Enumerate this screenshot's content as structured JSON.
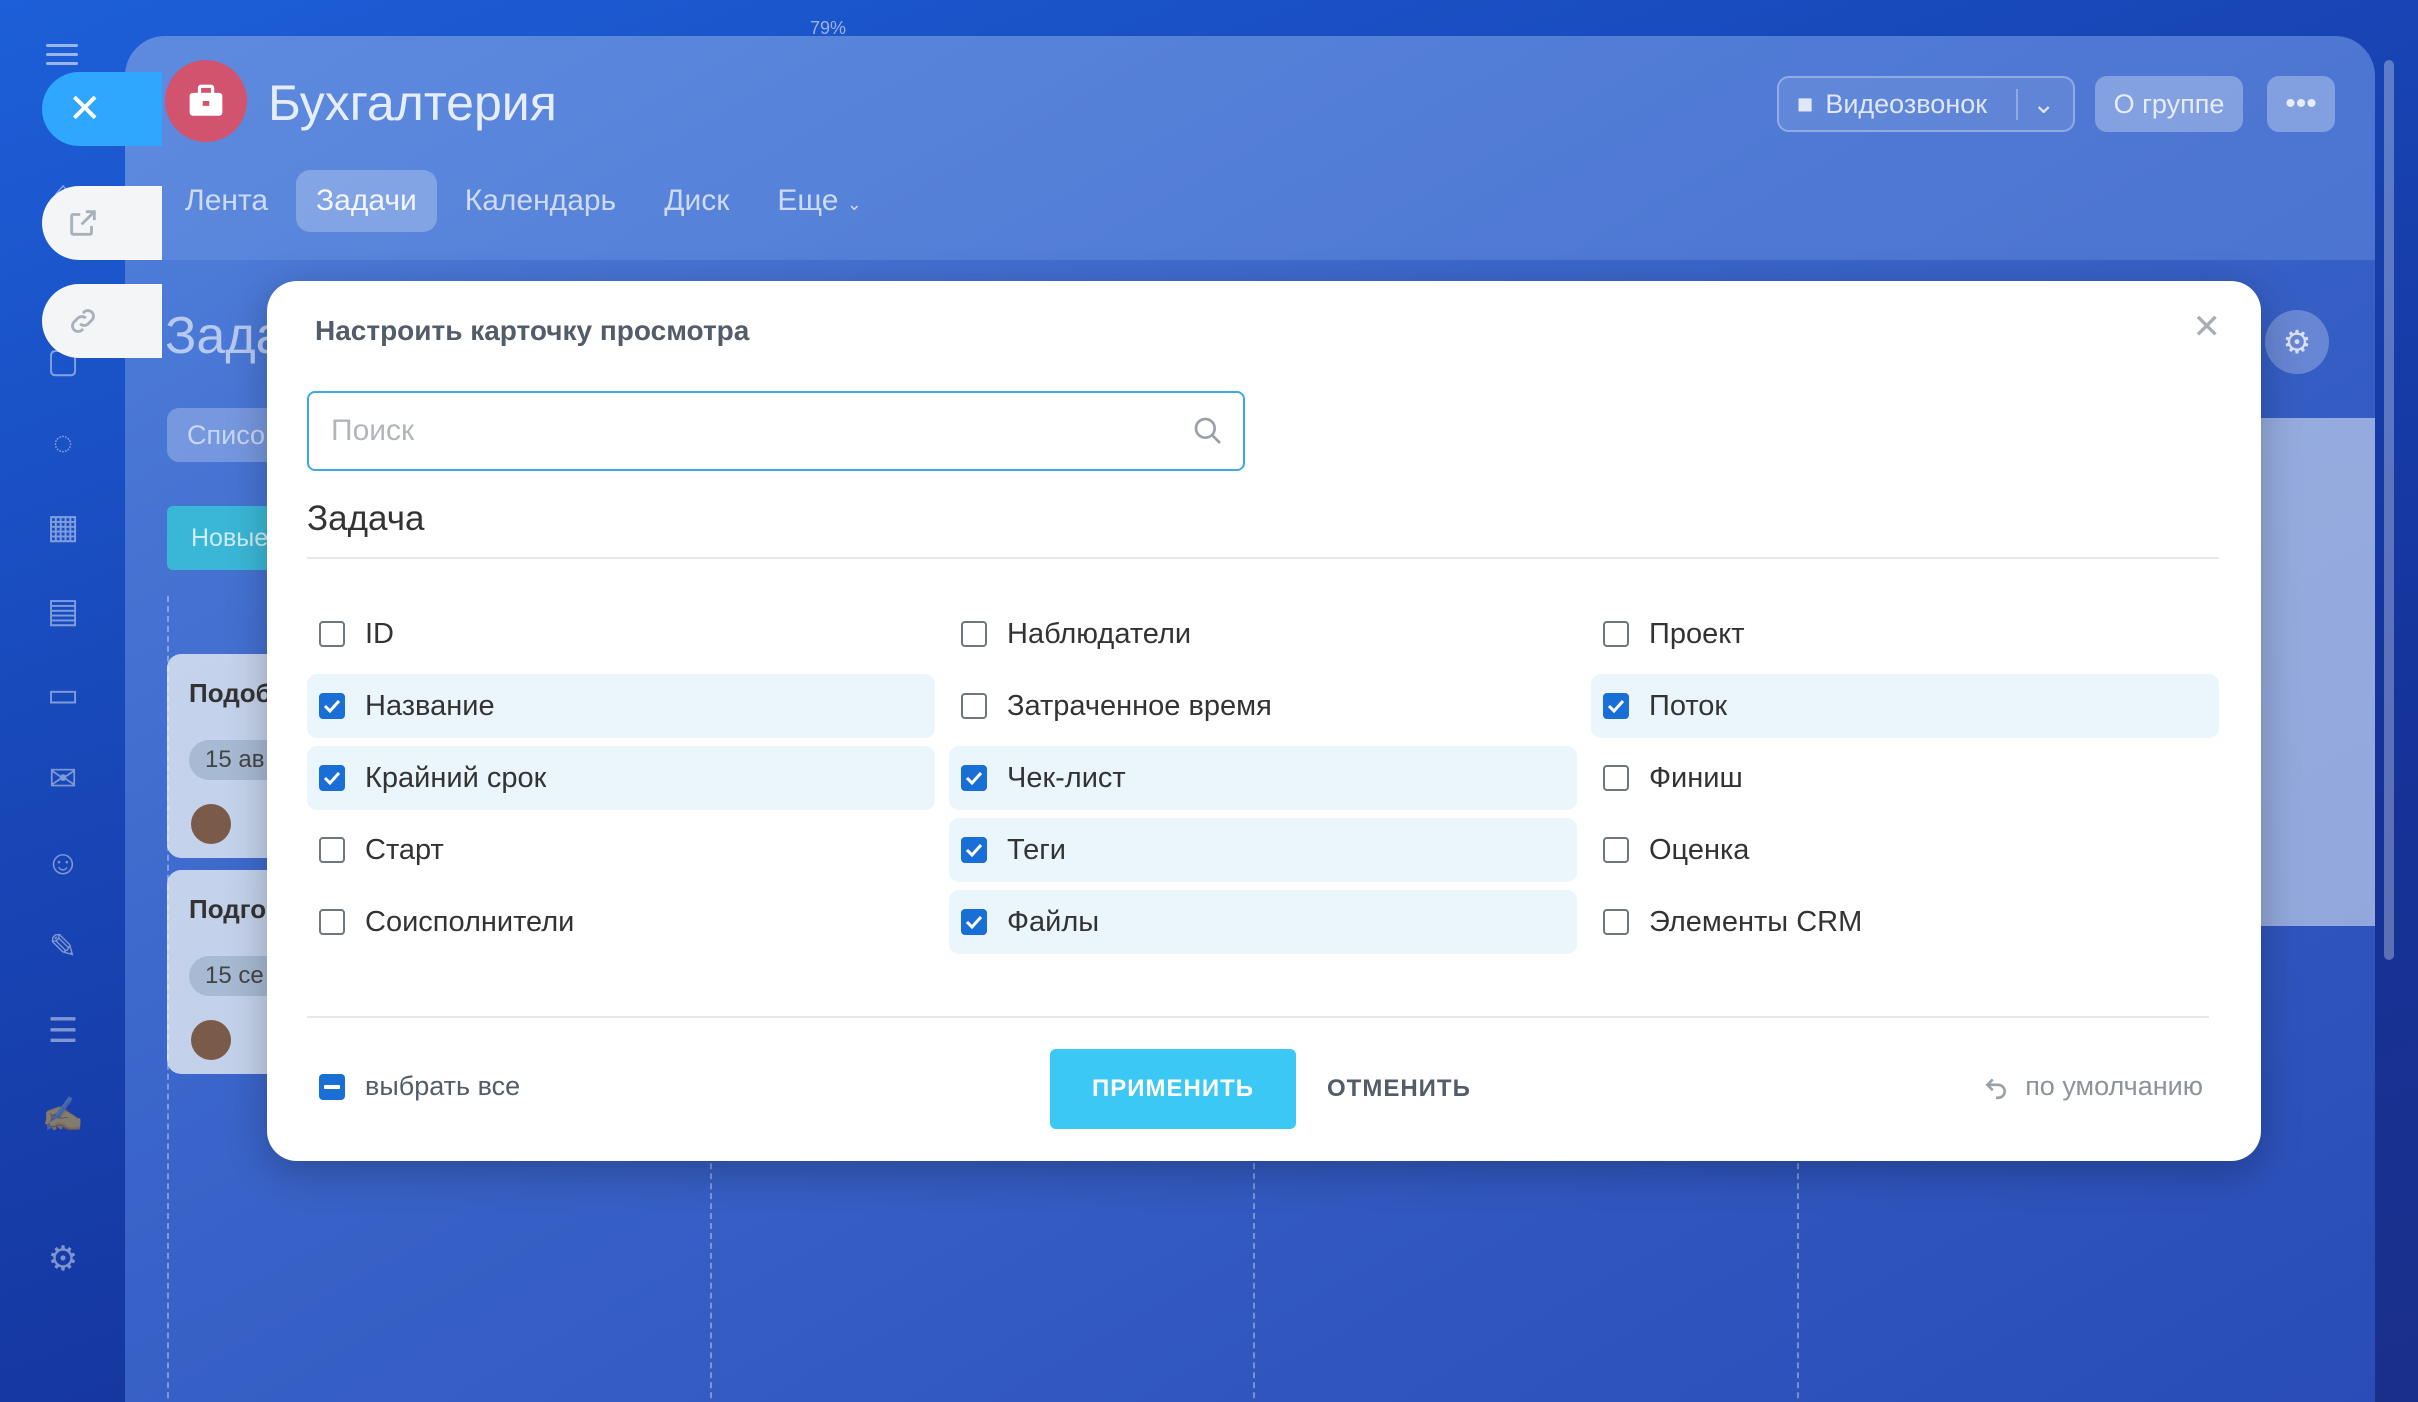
{
  "zoom": "79%",
  "group": {
    "title": "Бухгалтерия",
    "tabs": [
      "Лента",
      "Задачи",
      "Календарь",
      "Диск",
      "Еще"
    ],
    "active_tab": "Задачи",
    "video_call": "Видеозвонок",
    "about": "О группе"
  },
  "background": {
    "page_heading": "Зада",
    "list_pill": "Списо",
    "column_head": "Новые",
    "cards": [
      {
        "title": "Подоб",
        "date": "15 ав"
      },
      {
        "title": "Подго",
        "date": "15 се"
      }
    ]
  },
  "modal": {
    "title": "Настроить карточку просмотра",
    "search_placeholder": "Поиск",
    "section": "Задача",
    "columns": [
      [
        {
          "label": "ID",
          "checked": false
        },
        {
          "label": "Название",
          "checked": true
        },
        {
          "label": "Крайний срок",
          "checked": true
        },
        {
          "label": "Старт",
          "checked": false
        },
        {
          "label": "Соисполнители",
          "checked": false
        }
      ],
      [
        {
          "label": "Наблюдатели",
          "checked": false
        },
        {
          "label": "Затраченное время",
          "checked": false
        },
        {
          "label": "Чек-лист",
          "checked": true
        },
        {
          "label": "Теги",
          "checked": true
        },
        {
          "label": "Файлы",
          "checked": true
        }
      ],
      [
        {
          "label": "Проект",
          "checked": false
        },
        {
          "label": "Поток",
          "checked": true
        },
        {
          "label": "Финиш",
          "checked": false
        },
        {
          "label": "Оценка",
          "checked": false
        },
        {
          "label": "Элементы CRM",
          "checked": false
        }
      ]
    ],
    "select_all": "выбрать все",
    "apply": "ПРИМЕНИТЬ",
    "cancel": "ОТМЕНИТЬ",
    "reset_default": "по умолчанию"
  },
  "colors": {
    "accent": "#3bc8f5",
    "checkbox": "#1a6fd6",
    "checked_row": "#eaf6fc",
    "avatar": "#d2536e"
  }
}
